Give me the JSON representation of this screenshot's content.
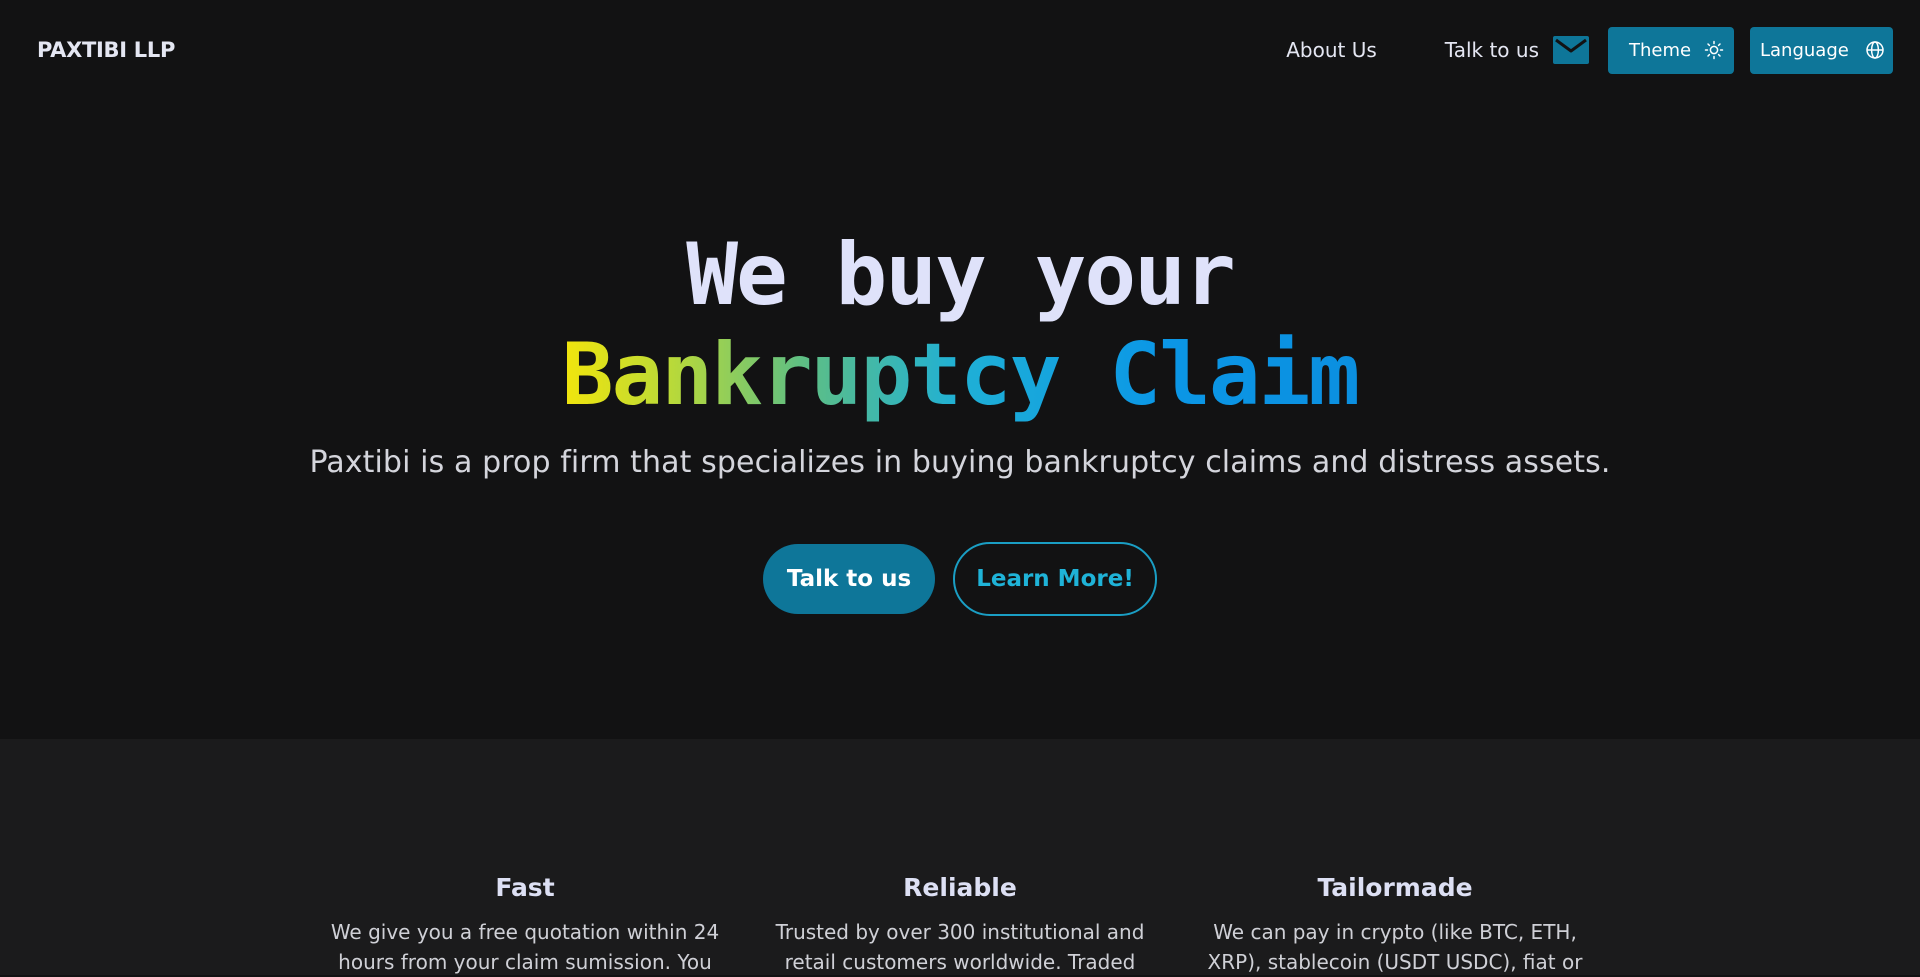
{
  "header": {
    "logo": "PAXTIBI LLP",
    "nav": {
      "about_label": "About Us",
      "talk_label": "Talk to us",
      "theme_label": "Theme",
      "language_label": "Language"
    }
  },
  "hero": {
    "title_line1": "We buy your",
    "title_line2": "Bankruptcy Claim",
    "subtitle": "Paxtibi is a prop firm that specializes in buying bankruptcy claims and distress assets.",
    "primary_cta": "Talk to us",
    "secondary_cta": "Learn More!"
  },
  "features": [
    {
      "title": "Fast",
      "text": "We give you a free quotation within 24 hours from your claim sumission. You"
    },
    {
      "title": "Reliable",
      "text": "Trusted by over 300 institutional and retail customers worldwide. Traded"
    },
    {
      "title": "Tailormade",
      "text": "We can pay in crypto (like BTC, ETH, XRP), stablecoin (USDT USDC), fiat or"
    }
  ],
  "colors": {
    "background": "#121213",
    "features_background": "#1b1b1c",
    "accent": "#0e7699",
    "accent_outline": "#1a9ec4",
    "gradient_start": "#f2e50c",
    "gradient_end": "#0b8fe0"
  },
  "icons": {
    "mail": "mail-icon",
    "theme": "sun-icon",
    "language": "globe-icon"
  }
}
